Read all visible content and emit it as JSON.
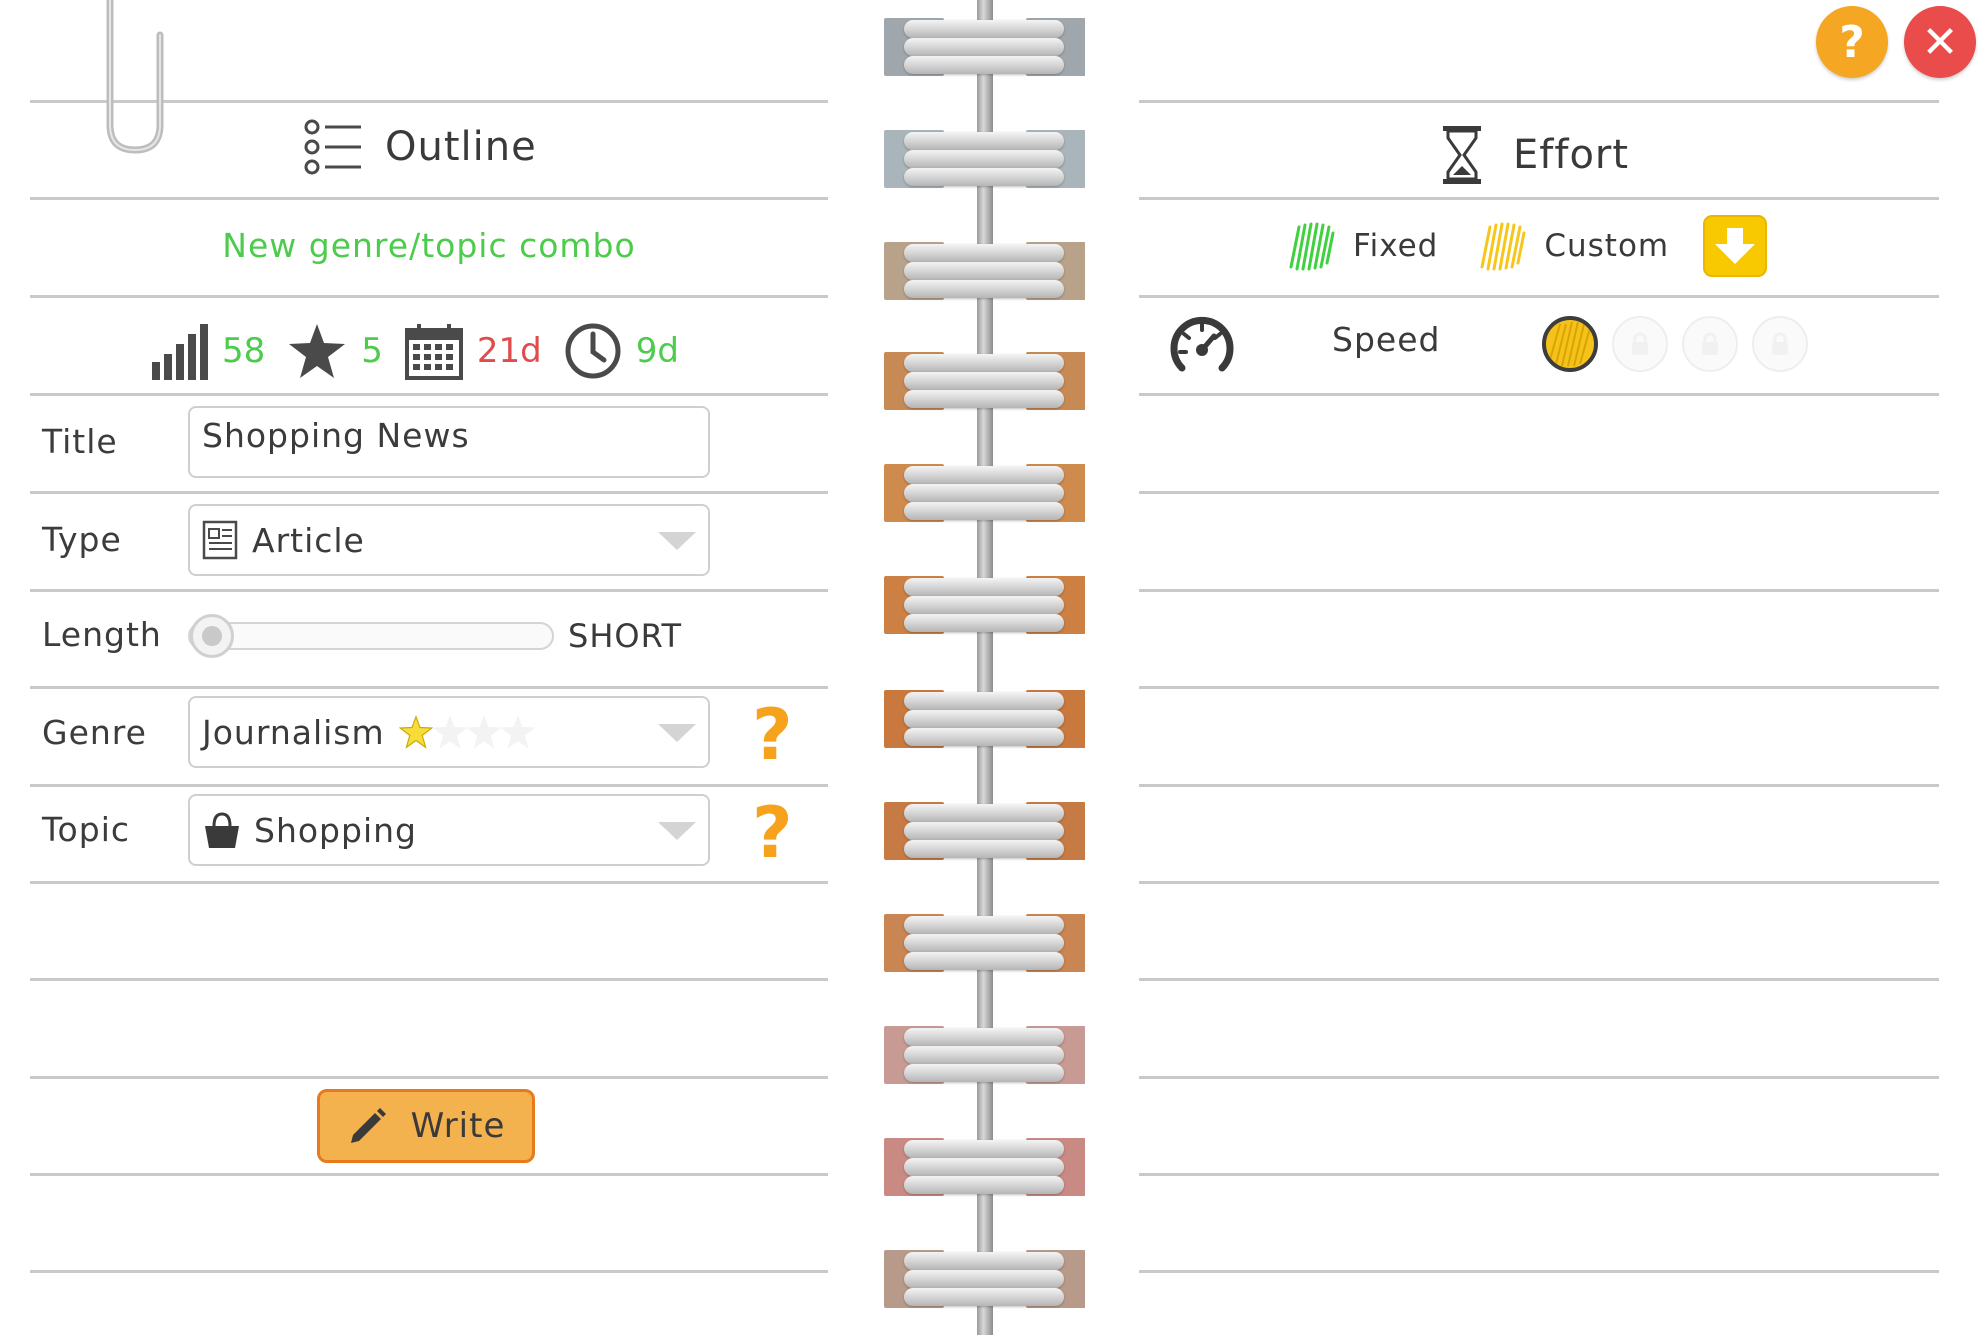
{
  "top_buttons": {
    "help": "?",
    "close": "✕"
  },
  "outline": {
    "title": "Outline",
    "icon": "list-icon",
    "combo_text": "New genre/topic combo",
    "stats": {
      "audience": "58",
      "rating": "5",
      "days": "21d",
      "time": "9d"
    },
    "colors": {
      "positive": "#4ccb4c",
      "negative": "#e04b4b",
      "accent": "#f7a21d"
    }
  },
  "form": {
    "title_label": "Title",
    "title_value": "Shopping News",
    "type_label": "Type",
    "type_value": "Article",
    "length_label": "Length",
    "length_value": "SHORT",
    "length_level": 0,
    "genre_label": "Genre",
    "genre_value": "Journalism",
    "genre_stars": 1,
    "genre_stars_max": 4,
    "topic_label": "Topic",
    "topic_value": "Shopping",
    "help_mark": "?"
  },
  "write_button": {
    "label": "Write"
  },
  "effort": {
    "title": "Effort",
    "icon": "hourglass-icon",
    "legend": {
      "fixed": "Fixed",
      "custom": "Custom"
    },
    "speed_label": "Speed",
    "speed_slots": [
      "custom",
      "locked",
      "locked",
      "locked"
    ]
  }
}
